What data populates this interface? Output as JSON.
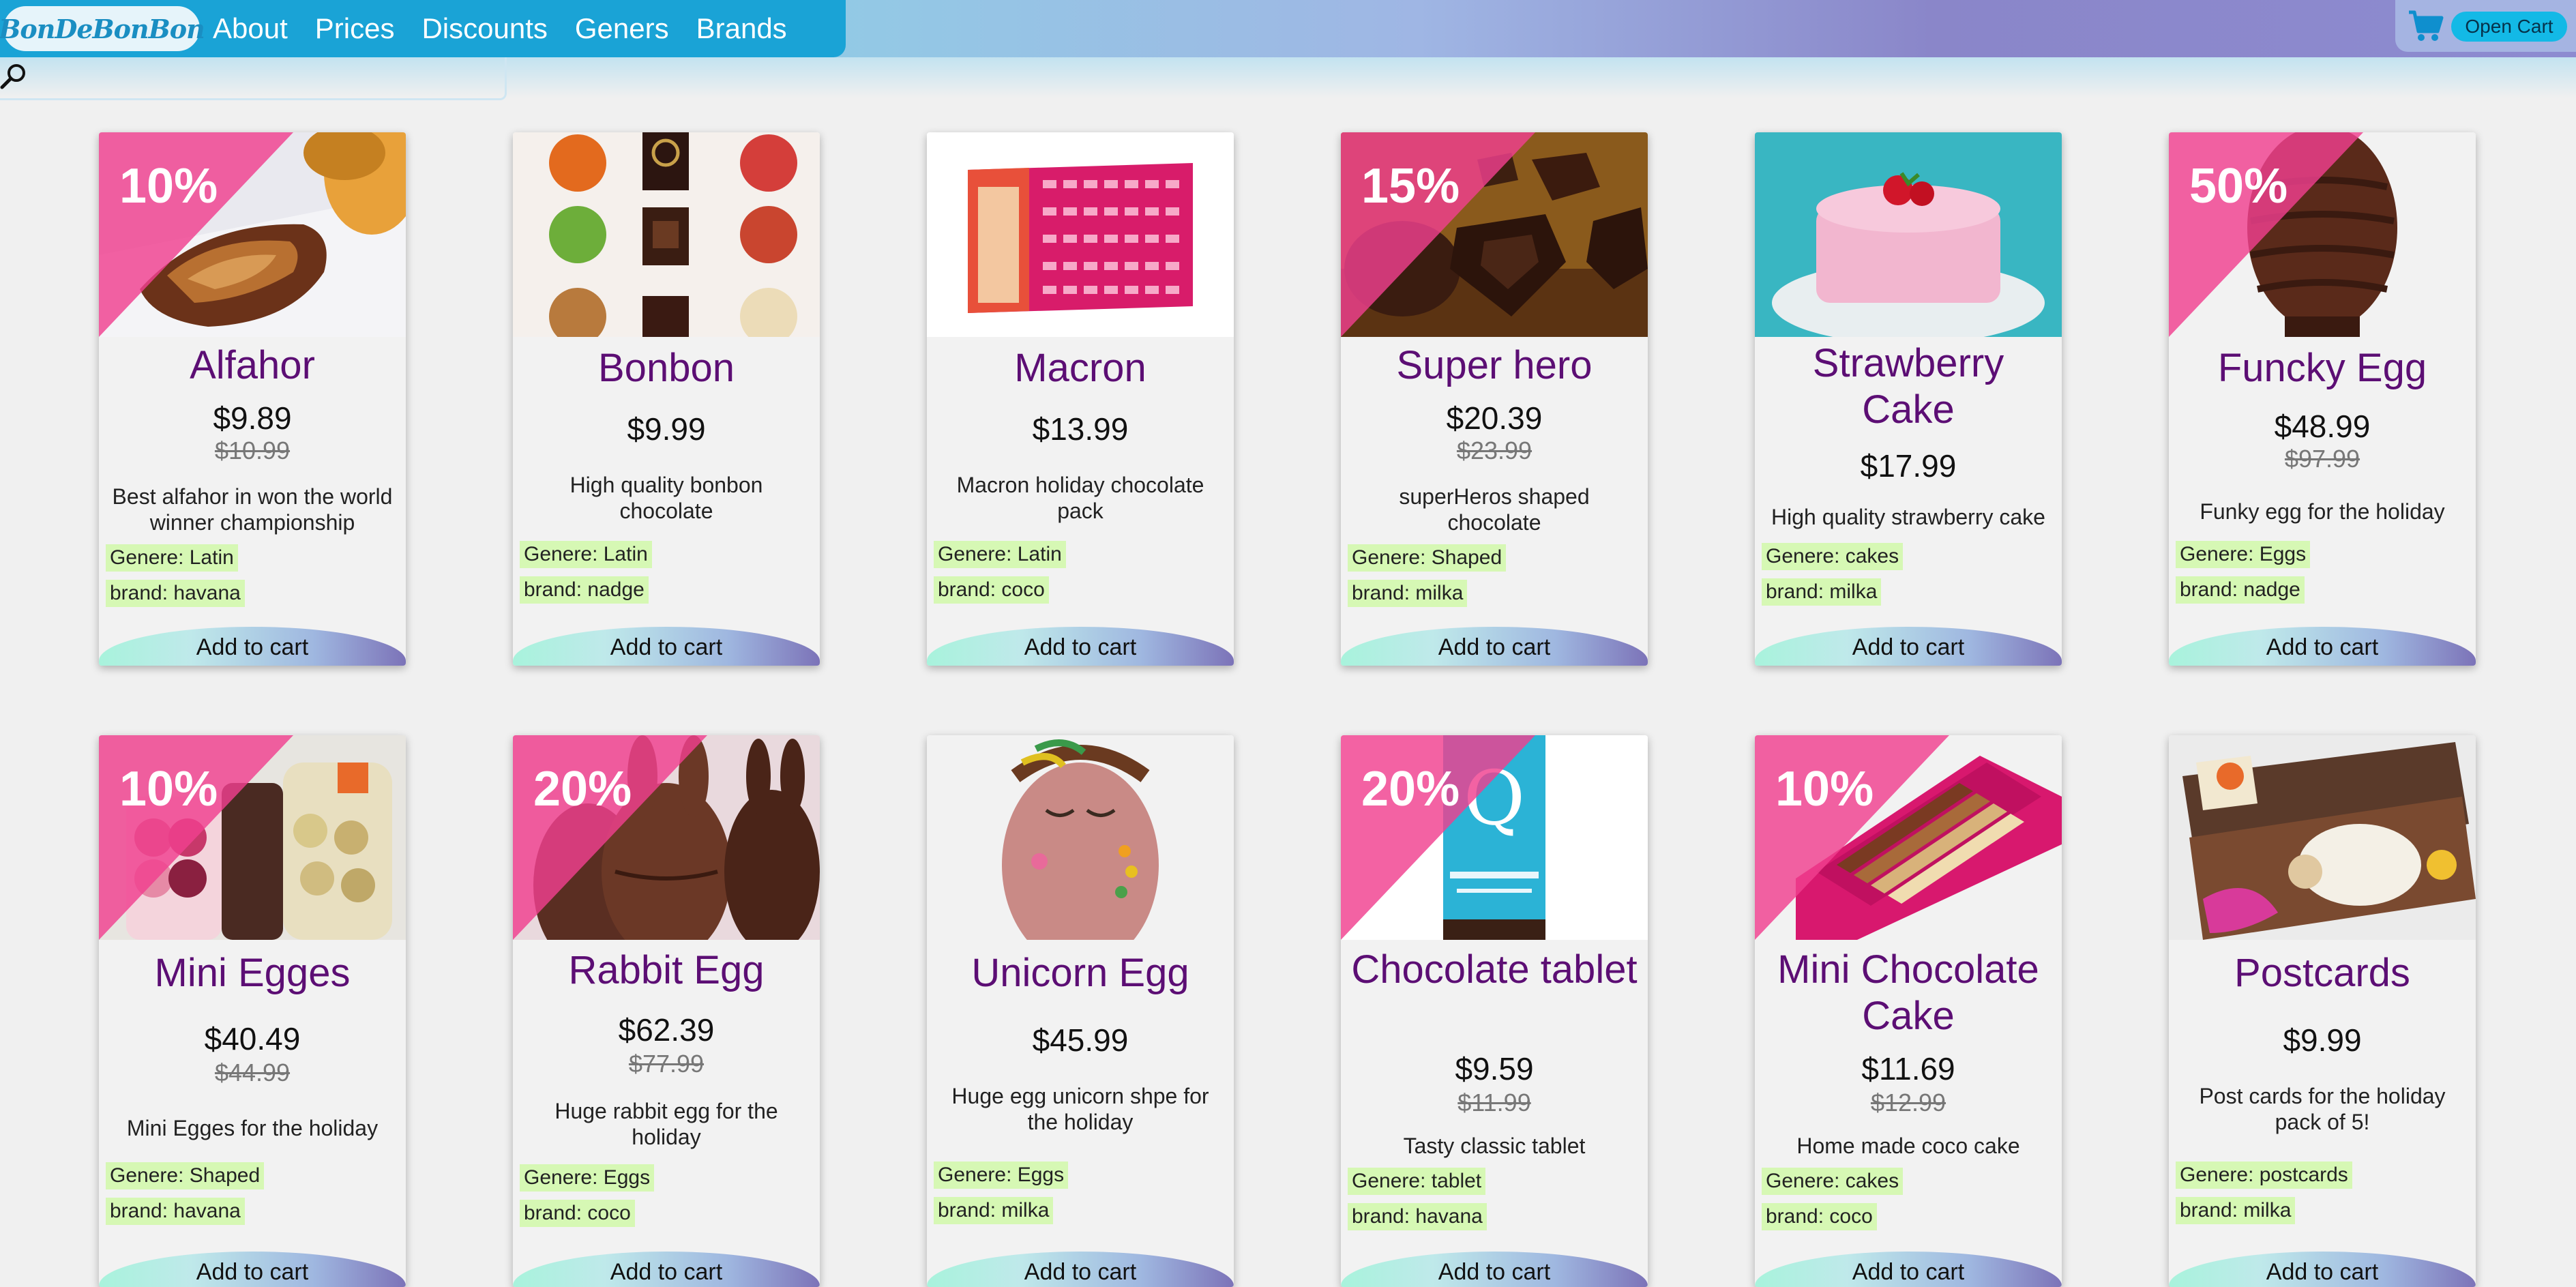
{
  "header": {
    "logo_text": "BonDeBonBon",
    "nav": [
      "About",
      "Prices",
      "Discounts",
      "Geners",
      "Brands"
    ],
    "open_cart_label": "Open Cart"
  },
  "search": {
    "placeholder": "",
    "value": ""
  },
  "colors": {
    "nav_bg": "#1aa3d6",
    "title": "#5c0e74",
    "badge": "#f0408f",
    "tag_bg": "#d6f8b4"
  },
  "add_label": "Add to cart",
  "products": [
    {
      "title": "Alfahor",
      "price": "$9.89",
      "old_price": "$10.99",
      "discount": "10%",
      "desc": "Best alfahor in won the world winner championship",
      "genre": "Genere: Latin",
      "brand": "brand: havana",
      "image": "alfahor-photo"
    },
    {
      "title": "Bonbon",
      "price": "$9.99",
      "old_price": "",
      "discount": "",
      "desc": "High quality bonbon chocolate",
      "genre": "Genere: Latin",
      "brand": "brand: nadge",
      "image": "bonbon-photo"
    },
    {
      "title": "Macron",
      "price": "$13.99",
      "old_price": "",
      "discount": "",
      "desc": "Macron holiday chocolate pack",
      "genre": "Genere: Latin",
      "brand": "brand: coco",
      "image": "macron-photo"
    },
    {
      "title": "Super hero",
      "price": "$20.39",
      "old_price": "$23.99",
      "discount": "15%",
      "desc": "superHeros shaped chocolate",
      "genre": "Genere: Shaped",
      "brand": "brand: milka",
      "image": "superhero-photo"
    },
    {
      "title": "Strawberry Cake",
      "price": "$17.99",
      "old_price": "",
      "discount": "",
      "desc": "High quality strawberry cake",
      "genre": "Genere: cakes",
      "brand": "brand: milka",
      "image": "strawberry-cake-photo"
    },
    {
      "title": "Funcky Egg",
      "price": "$48.99",
      "old_price": "$97.99",
      "discount": "50%",
      "desc": "Funky egg for the holiday",
      "genre": "Genere: Eggs",
      "brand": "brand: nadge",
      "image": "funky-egg-photo"
    },
    {
      "title": "Mini Egges",
      "price": "$40.49",
      "old_price": "$44.99",
      "discount": "10%",
      "desc": "Mini Egges for the holiday",
      "genre": "Genere: Shaped",
      "brand": "brand: havana",
      "image": "mini-eggs-photo"
    },
    {
      "title": "Rabbit Egg",
      "price": "$62.39",
      "old_price": "$77.99",
      "discount": "20%",
      "desc": "Huge rabbit egg for the holiday",
      "genre": "Genere: Eggs",
      "brand": "brand: coco",
      "image": "rabbit-egg-photo"
    },
    {
      "title": "Unicorn Egg",
      "price": "$45.99",
      "old_price": "",
      "discount": "",
      "desc": "Huge egg unicorn shpe for the holiday",
      "genre": "Genere: Eggs",
      "brand": "brand: milka",
      "image": "unicorn-egg-photo"
    },
    {
      "title": "Chocolate tablet",
      "price": "$9.59",
      "old_price": "$11.99",
      "discount": "20%",
      "desc": "Tasty classic tablet",
      "genre": "Genere: tablet",
      "brand": "brand: havana",
      "image": "chocolate-tablet-photo"
    },
    {
      "title": "Mini Chocolate Cake",
      "price": "$11.69",
      "old_price": "$12.99",
      "discount": "10%",
      "desc": "Home made coco cake",
      "genre": "Genere: cakes",
      "brand": "brand: coco",
      "image": "mini-chocolate-cake-photo"
    },
    {
      "title": "Postcards",
      "price": "$9.99",
      "old_price": "",
      "discount": "",
      "desc": "Post cards for the holiday pack of 5!",
      "genre": "Genere: postcards",
      "brand": "brand: milka",
      "image": "postcards-photo"
    }
  ]
}
